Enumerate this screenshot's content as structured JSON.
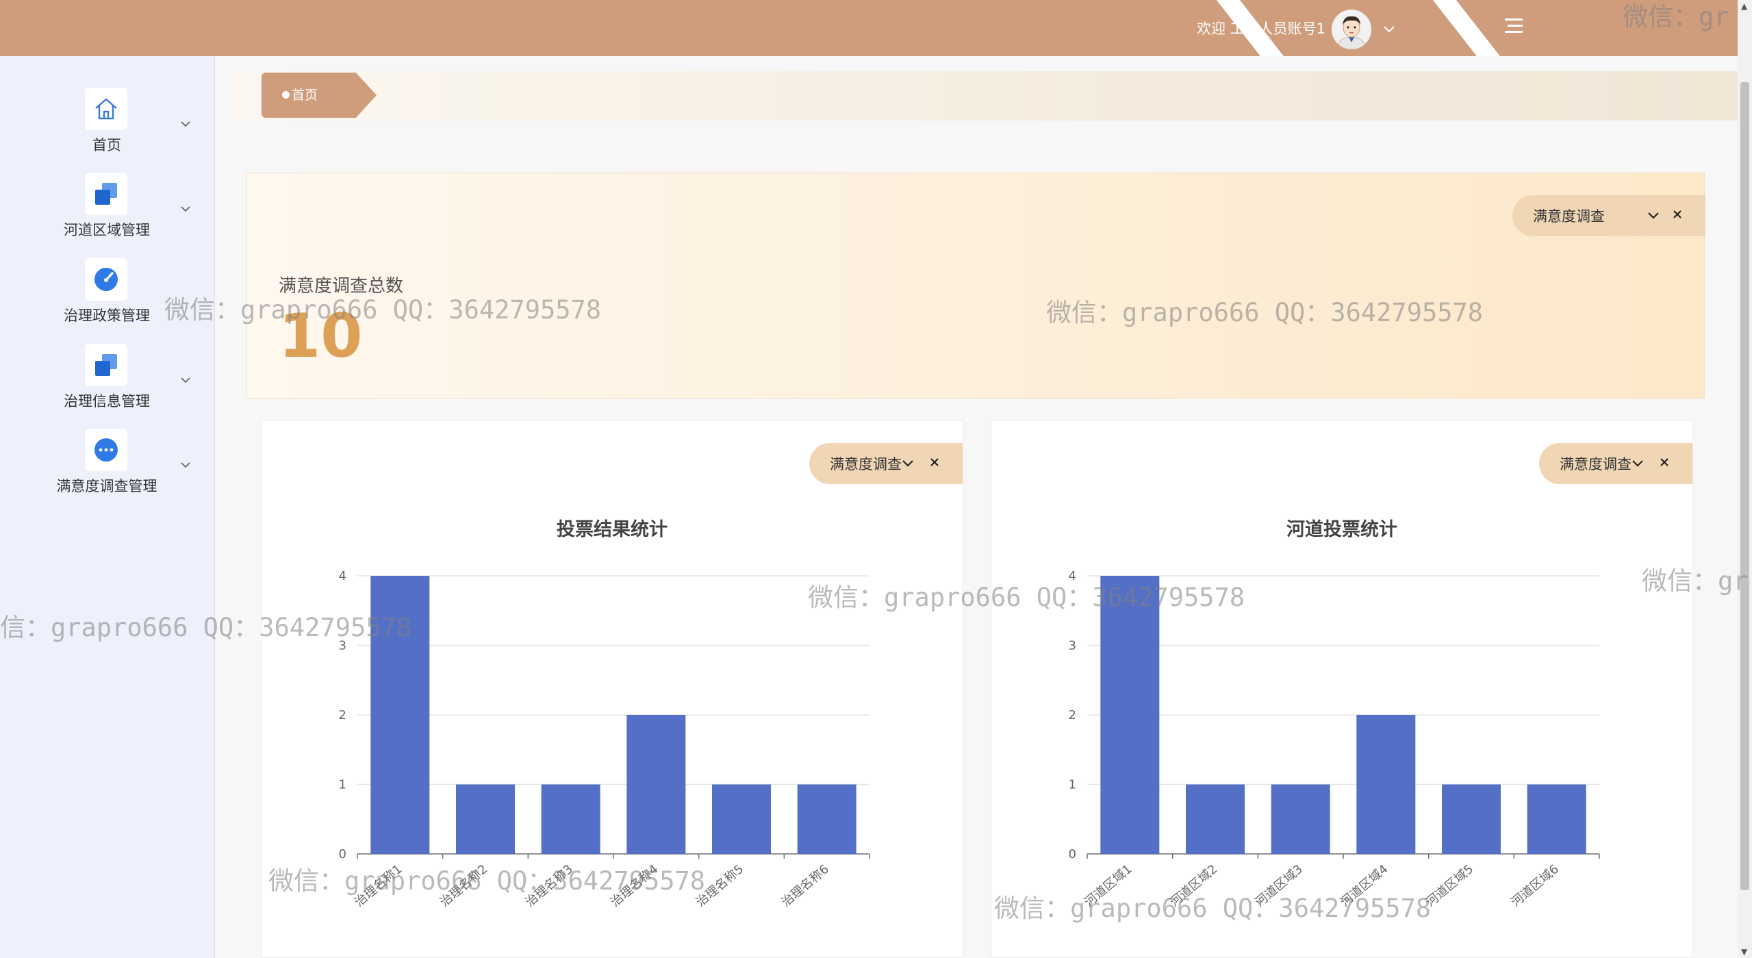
{
  "header": {
    "welcome": "欢迎 工作人员账号1",
    "avatar_icon": "user-avatar-icon",
    "menu_icon": "menu-toggle-icon",
    "bg_color": "#cf9c7c"
  },
  "sidebar": {
    "items": [
      {
        "label": "首页",
        "icon": "home-icon"
      },
      {
        "label": "河道区域管理",
        "icon": "stack-icon"
      },
      {
        "label": "治理政策管理",
        "icon": "gauge-icon"
      },
      {
        "label": "治理信息管理",
        "icon": "stack-icon"
      },
      {
        "label": "满意度调查管理",
        "icon": "dots-icon"
      }
    ]
  },
  "breadcrumb": {
    "current": "首页"
  },
  "summary": {
    "label": "满意度调查总数",
    "value": "10",
    "filter": "满意度调查"
  },
  "charts": {
    "left_filter": "满意度调查",
    "right_filter": "满意度调查"
  },
  "chart_data": [
    {
      "type": "bar",
      "title": "投票结果统计",
      "categories": [
        "治理名称1",
        "治理名称2",
        "治理名称3",
        "治理名称4",
        "治理名称5",
        "治理名称6"
      ],
      "values": [
        4,
        1,
        1,
        2,
        1,
        1
      ],
      "ylim": [
        0,
        4
      ],
      "yticks": [
        0,
        1,
        2,
        3,
        4
      ],
      "color": "#5470c6",
      "grid": true
    },
    {
      "type": "bar",
      "title": "河道投票统计",
      "categories": [
        "河道区域1",
        "河道区域2",
        "河道区域3",
        "河道区域4",
        "河道区域5",
        "河道区域6"
      ],
      "values": [
        4,
        1,
        1,
        2,
        1,
        1
      ],
      "ylim": [
        0,
        4
      ],
      "yticks": [
        0,
        1,
        2,
        3,
        4
      ],
      "color": "#5470c6",
      "grid": true
    }
  ],
  "watermark": "微信：grapro666 QQ：3642795578",
  "watermark_partial": "微信：gr",
  "watermark_partial_left": "信：grapro666 QQ：3642795578"
}
